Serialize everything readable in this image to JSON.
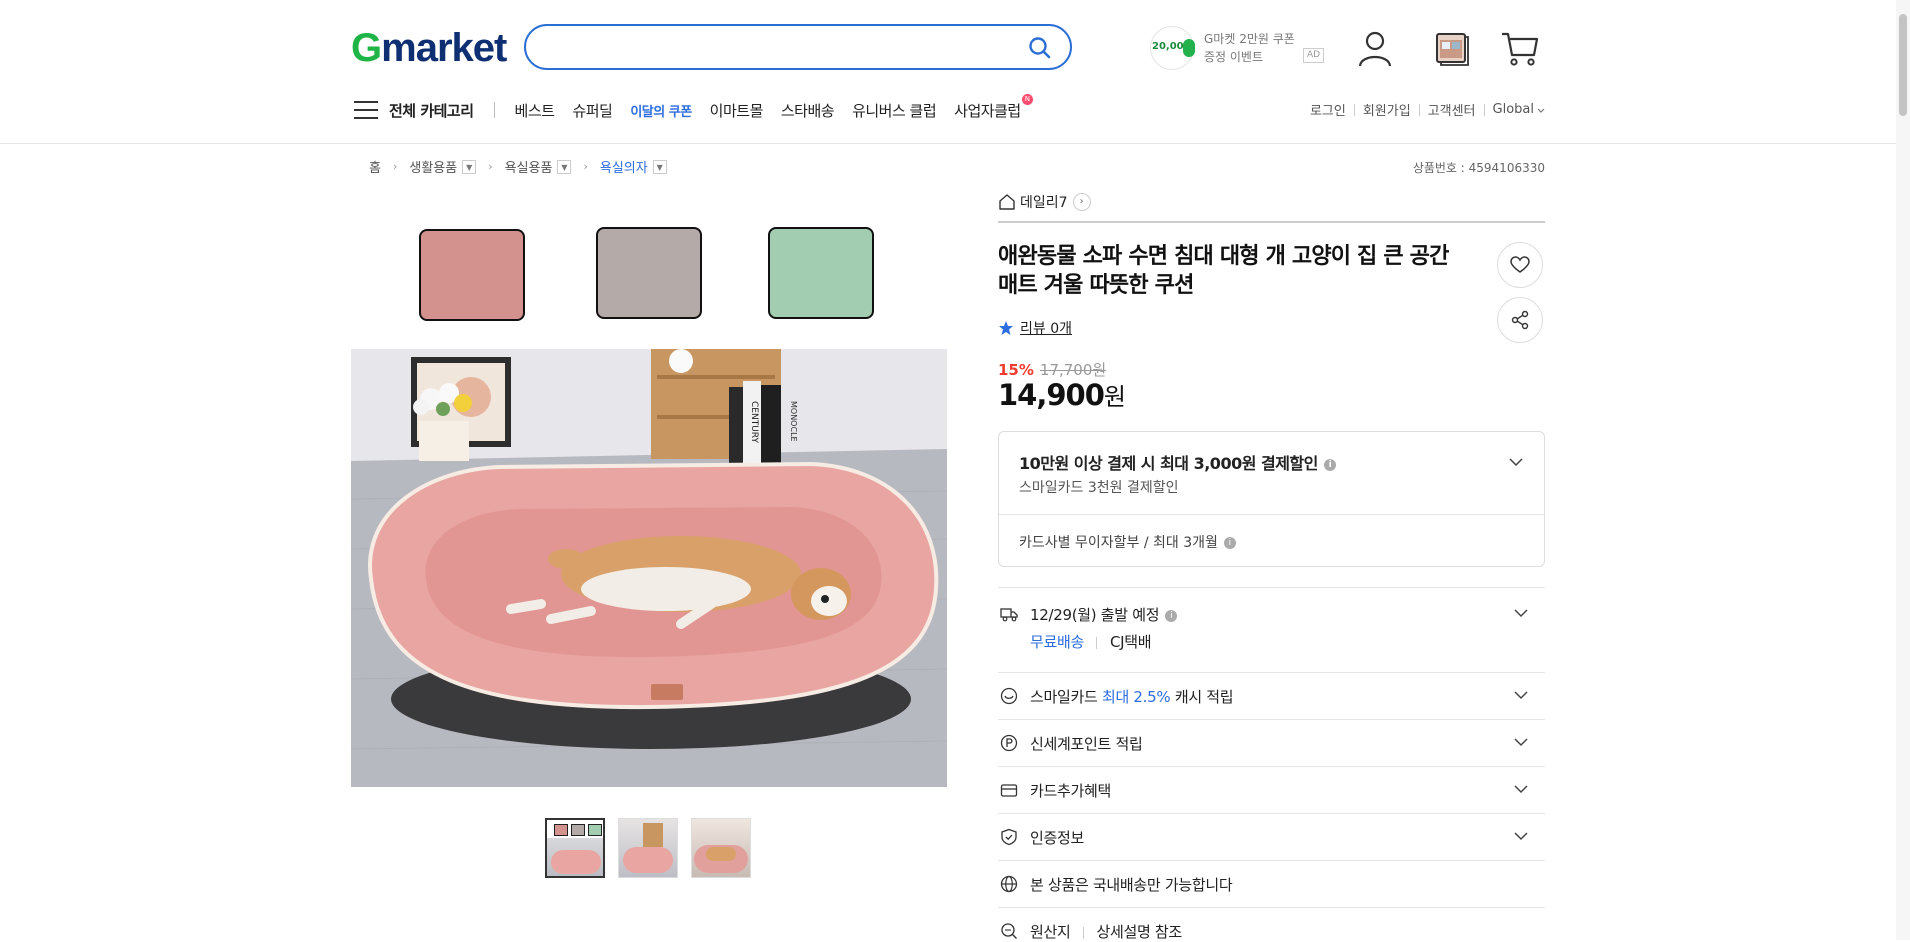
{
  "header": {
    "logo_g": "G",
    "logo_rest": "market",
    "search": {
      "value": "",
      "placeholder": ""
    },
    "promo": {
      "coin": "20,000",
      "line1": "G마켓 2만원 쿠폰",
      "line2": "증정 이벤트",
      "ad": "AD"
    },
    "icons": [
      "search-icon",
      "user-icon",
      "recent-items-icon",
      "cart-icon"
    ]
  },
  "nav": {
    "category_label": "전체 카테고리",
    "items": [
      {
        "label": "베스트"
      },
      {
        "label": "슈퍼딜"
      },
      {
        "label": "이달의 쿠폰"
      },
      {
        "label": "이마트몰"
      },
      {
        "label": "스타배송"
      },
      {
        "label": "유니버스 클럽"
      },
      {
        "label": "사업자클럽",
        "badge": "N"
      }
    ],
    "util": [
      "로그인",
      "회원가입",
      "고객센터",
      "Global"
    ]
  },
  "breadcrumb": {
    "items": [
      "홈",
      "생활용품",
      "욕실용품",
      "욕실의자"
    ]
  },
  "product_no": "상품번호 : 4594106330",
  "gallery": {
    "swatch_colors": [
      "#d4928f",
      "#b4aaa8",
      "#a2cdb1"
    ],
    "bed_color": "#e8a5a2",
    "thumbnails": [
      "thumbnail-color-options",
      "thumbnail-dog-bed-bookshelf",
      "thumbnail-dog-bed-sleeping"
    ],
    "selected_thumbnail": 0,
    "book_spine_1": "CENTURY",
    "book_spine_2": "MONOCLE"
  },
  "product": {
    "seller": "데일리7",
    "title": "애완동물 소파 수면 침대 대형 개 고양이 집 큰 공간 매트 겨울 따뜻한 쿠션",
    "review_link": "리뷰 0개",
    "discount": "15%",
    "original_price": "17,700원",
    "price": "14,900",
    "price_unit": "원"
  },
  "benefit_box": {
    "headline": "10만원 이상 결제 시 최대 3,000원 결제할인",
    "sub": "스마일카드 3천원 결제할인",
    "installment": "카드사별 무이자할부 / 최대 3개월"
  },
  "rows": {
    "shipping": {
      "date": "12/29(월) 출발 예정",
      "free": "무료배송",
      "courier": "CJ택배"
    },
    "smile_pre": "스마일카드 ",
    "smile_hl": "최대 2.5%",
    "smile_post": " 캐시 적립",
    "points": "신세계포인트 적립",
    "card": "카드추가혜택",
    "cert": "인증정보",
    "domestic": "본 상품은 국내배송만 가능합니다",
    "origin_label": "원산지",
    "origin_value": "상세설명 참조"
  }
}
